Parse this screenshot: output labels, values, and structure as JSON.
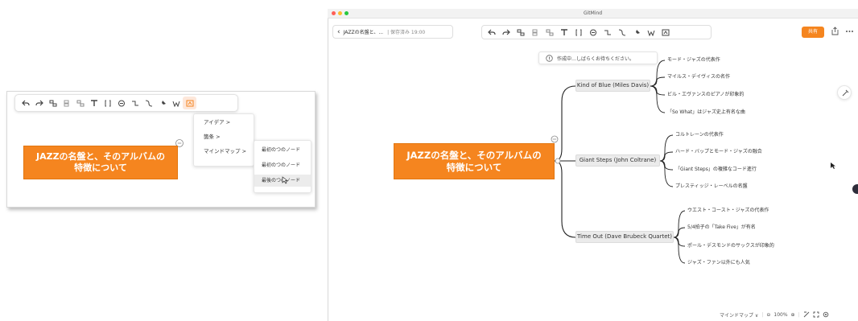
{
  "left_panel": {
    "central_topic": "JAZZの名盤と、そのアルバムの特徴について",
    "menu_level1": [
      {
        "label": "アイデア",
        "arrow": ">"
      },
      {
        "label": "箇条",
        "arrow": ">"
      },
      {
        "label": "マインドマップ",
        "arrow": ">"
      }
    ],
    "menu_level2": [
      {
        "label": "最初のつのノード"
      },
      {
        "label": "最初のつのノード"
      },
      {
        "label": "最後のつのノード"
      }
    ],
    "toolbar_icons": [
      "undo-icon",
      "redo-icon",
      "child-node-icon",
      "sibling-node-icon",
      "subtopic-icon",
      "insert-node-icon",
      "bracket-icon",
      "summary-icon",
      "relationship-icon",
      "connector-icon",
      "pin-icon",
      "format-icon",
      "ai-icon"
    ]
  },
  "window": {
    "title": "GitMind",
    "back_label": "JAZZの名盤と、...",
    "doc_status": "| 保存済み 19:00",
    "share_label": "共有",
    "hint": "作成中…しばらくお待ちください。",
    "central_topic": "JAZZの名盤と、そのアルバムの特徴について",
    "toolbar_icons": [
      "undo-icon",
      "redo-icon",
      "child-node-icon",
      "sibling-node-icon",
      "subtopic-icon",
      "insert-node-icon",
      "bracket-icon",
      "summary-icon",
      "relationship-icon",
      "connector-icon",
      "pin-icon",
      "format-icon",
      "ai-icon"
    ],
    "albums": [
      {
        "label": "Kind of Blue (Miles Davis)",
        "leaves": [
          "モード・ジャズの代表作",
          "マイルス・デイヴィスの名作",
          "ビル・エヴァンスのピアノが印象的",
          "「So What」はジャズ史上有名な曲"
        ]
      },
      {
        "label": "Giant Steps (John Coltrane)",
        "leaves": [
          "コルトレーンの代表作",
          "ハード・バップとモード・ジャズの融合",
          "「Giant Steps」の複雑なコード進行",
          "プレスティッジ・レーベルの名盤"
        ]
      },
      {
        "label": "Time Out (Dave Brubeck Quartet)",
        "leaves": [
          "ウエスト・コースト・ジャズの代表作",
          "5/4拍子の「Take Five」が有名",
          "ポール・デスモンドのサックスが印象的",
          "ジャズ・ファン以外にも人気"
        ]
      }
    ],
    "status_bar": {
      "view_mode": "マインドマップ ∨",
      "zoom_out": "⊖",
      "zoom": "100%",
      "zoom_in": "⊕"
    }
  }
}
